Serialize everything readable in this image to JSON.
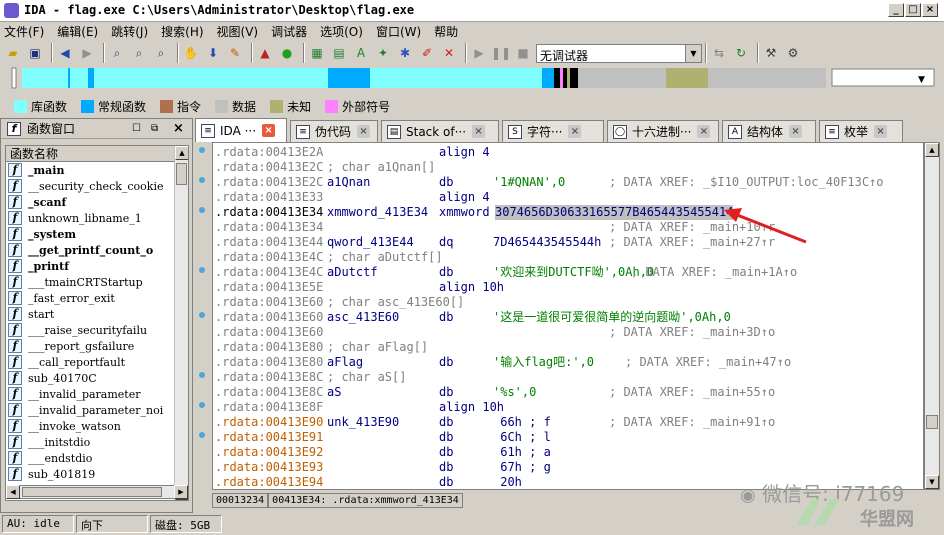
{
  "window": {
    "title": "IDA - flag.exe C:\\Users\\Administrator\\Desktop\\flag.exe",
    "min": "_",
    "max": "□",
    "close": "×"
  },
  "menu": [
    "文件(F)",
    "编辑(E)",
    "跳转(J)",
    "搜索(H)",
    "视图(V)",
    "调试器",
    "选项(O)",
    "窗口(W)",
    "帮助"
  ],
  "toolbar": {
    "debugger_combo": "无调试器"
  },
  "legend": [
    {
      "label": "库函数",
      "color": "#80ffff"
    },
    {
      "label": "常规函数",
      "color": "#00aaff"
    },
    {
      "label": "指令",
      "color": "#b07050"
    },
    {
      "label": "数据",
      "color": "#c0c0c0"
    },
    {
      "label": "未知",
      "color": "#b0b070"
    },
    {
      "label": "外部符号",
      "color": "#ff80ff"
    }
  ],
  "functions_panel": {
    "title": "函数窗口",
    "column": "函数名称",
    "items": [
      {
        "name": "_main",
        "bold": true
      },
      {
        "name": "__security_check_cookie",
        "bold": false
      },
      {
        "name": "_scanf",
        "bold": true
      },
      {
        "name": "unknown_libname_1",
        "bold": false
      },
      {
        "name": "_system",
        "bold": true
      },
      {
        "name": "__get_printf_count_o",
        "bold": true
      },
      {
        "name": "_printf",
        "bold": true
      },
      {
        "name": "___tmainCRTStartup",
        "bold": false
      },
      {
        "name": "_fast_error_exit",
        "bold": false
      },
      {
        "name": "start",
        "bold": false
      },
      {
        "name": "___raise_securityfailu",
        "bold": false
      },
      {
        "name": "___report_gsfailure",
        "bold": false
      },
      {
        "name": "__call_reportfault",
        "bold": false
      },
      {
        "name": "sub_40170C",
        "bold": false
      },
      {
        "name": "__invalid_parameter",
        "bold": false
      },
      {
        "name": "__invalid_parameter_noi",
        "bold": false
      },
      {
        "name": "__invoke_watson",
        "bold": false
      },
      {
        "name": "___initstdio",
        "bold": false
      },
      {
        "name": "___endstdio",
        "bold": false
      },
      {
        "name": "sub_401819",
        "bold": false
      }
    ]
  },
  "tabs": [
    {
      "label": "IDA ···",
      "icon": "ida-view-icon",
      "active": true
    },
    {
      "label": "伪代码",
      "icon": "pseudocode-icon",
      "active": false
    },
    {
      "label": "Stack of···",
      "icon": "stack-icon",
      "active": false
    },
    {
      "label": "字符···",
      "icon": "strings-icon",
      "active": false
    },
    {
      "label": "十六进制···",
      "icon": "hex-icon",
      "active": false
    },
    {
      "label": "结构体",
      "icon": "struct-icon",
      "active": false
    },
    {
      "label": "枚举",
      "icon": "enum-icon",
      "active": false
    }
  ],
  "code_lines": [
    {
      "addr": ".rdata:00413E2A",
      "label": "",
      "op": "align 4",
      "arg": "",
      "comment": ""
    },
    {
      "addr": ".rdata:00413E2C",
      "label": "; char a1Qnan[]",
      "op": "",
      "arg": "",
      "comment": ""
    },
    {
      "addr": ".rdata:00413E2C",
      "label": "a1Qnan",
      "op": "db",
      "arg": "'1#QNAN',0",
      "comment": "; DATA XREF: _$I10_OUTPUT:loc_40F13C↑o"
    },
    {
      "addr": ".rdata:00413E33",
      "label": "",
      "op": "align 4",
      "arg": "",
      "comment": ""
    },
    {
      "addr": ".rdata:00413E34",
      "label": "xmmword_413E34",
      "op": "xmmword",
      "arg": "3074656D30633165577B4654435455414",
      "comment": ""
    },
    {
      "addr": ".rdata:00413E34",
      "label": "",
      "op": "",
      "arg": "",
      "comment": "; DATA XREF: _main+10↑r"
    },
    {
      "addr": ".rdata:00413E44",
      "label": "qword_413E44",
      "op": "dq",
      "arg": "7D465443545544h",
      "comment": "; DATA XREF: _main+27↑r"
    },
    {
      "addr": ".rdata:00413E4C",
      "label": "; char aDutctf[]",
      "op": "",
      "arg": "",
      "comment": ""
    },
    {
      "addr": ".rdata:00413E4C",
      "label": "aDutctf",
      "op": "db",
      "arg": "'欢迎来到DUTCTF呦',0Ah,0",
      "comment": "; DATA XREF: _main+1A↑o"
    },
    {
      "addr": ".rdata:00413E5E",
      "label": "",
      "op": "align 10h",
      "arg": "",
      "comment": ""
    },
    {
      "addr": ".rdata:00413E60",
      "label": "; char asc_413E60[]",
      "op": "",
      "arg": "",
      "comment": ""
    },
    {
      "addr": ".rdata:00413E60",
      "label": "asc_413E60",
      "op": "db",
      "arg": "'这是一道很可爱很简单的逆向题呦',0Ah,0",
      "comment": ""
    },
    {
      "addr": ".rdata:00413E60",
      "label": "",
      "op": "",
      "arg": "",
      "comment": "; DATA XREF: _main+3D↑o"
    },
    {
      "addr": ".rdata:00413E80",
      "label": "; char aFlag[]",
      "op": "",
      "arg": "",
      "comment": ""
    },
    {
      "addr": ".rdata:00413E80",
      "label": "aFlag",
      "op": "db",
      "arg": "'输入flag吧:',0",
      "comment": "; DATA XREF: _main+47↑o"
    },
    {
      "addr": ".rdata:00413E8C",
      "label": "; char aS[]",
      "op": "",
      "arg": "",
      "comment": ""
    },
    {
      "addr": ".rdata:00413E8C",
      "label": "aS",
      "op": "db",
      "arg": "'%s',0",
      "comment": "; DATA XREF: _main+55↑o"
    },
    {
      "addr": ".rdata:00413E8F",
      "label": "",
      "op": "align 10h",
      "arg": "",
      "comment": ""
    },
    {
      "addr": ".rdata:00413E90",
      "label": "unk_413E90",
      "op": "db",
      "arg": " 66h ; f",
      "comment": "; DATA XREF: _main+91↑o"
    },
    {
      "addr": ".rdata:00413E91",
      "label": "",
      "op": "db",
      "arg": " 6Ch ; l",
      "comment": ""
    },
    {
      "addr": ".rdata:00413E92",
      "label": "",
      "op": "db",
      "arg": " 61h ; a",
      "comment": ""
    },
    {
      "addr": ".rdata:00413E93",
      "label": "",
      "op": "db",
      "arg": " 67h ; g",
      "comment": ""
    },
    {
      "addr": ".rdata:00413E94",
      "label": "",
      "op": "db",
      "arg": " 20h",
      "comment": ""
    }
  ],
  "location_bar": {
    "offset": "00013234",
    "location": "00413E34: .rdata:xmmword_413E34"
  },
  "statusbar": {
    "au": "AU:  idle",
    "direction": "向下",
    "disk": "磁盘: 5GB"
  },
  "watermark": {
    "line1": "微信号: i77169",
    "line2": "华盟网"
  }
}
